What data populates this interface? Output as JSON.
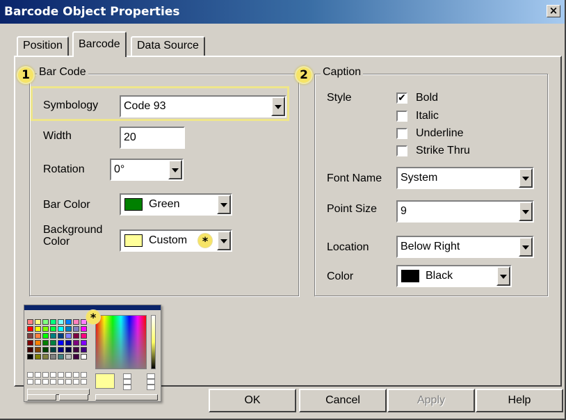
{
  "window": {
    "title": "Barcode Object Properties",
    "close_glyph": "×"
  },
  "tabs": [
    {
      "label": "Position",
      "active": false
    },
    {
      "label": "Barcode",
      "active": true
    },
    {
      "label": "Data Source",
      "active": false
    }
  ],
  "barcode_group": {
    "badge": "1",
    "title": "Bar Code",
    "symbology": {
      "label": "Symbology",
      "value": "Code 93"
    },
    "width": {
      "label": "Width",
      "value": "20"
    },
    "rotation": {
      "label": "Rotation",
      "value": "0°"
    },
    "bar_color": {
      "label": "Bar Color",
      "value": "Green",
      "swatch": "#008000"
    },
    "background_color": {
      "label_line1": "Background",
      "label_line2": "Color",
      "value": "Custom",
      "swatch": "#ffff99",
      "marker": "*"
    }
  },
  "caption_group": {
    "badge": "2",
    "title": "Caption",
    "style_label": "Style",
    "styles": [
      {
        "label": "Bold",
        "checked": true
      },
      {
        "label": "Italic",
        "checked": false
      },
      {
        "label": "Underline",
        "checked": false
      },
      {
        "label": "Strike Thru",
        "checked": false
      }
    ],
    "font_name": {
      "label": "Font Name",
      "value": "System"
    },
    "point_size": {
      "label": "Point Size",
      "value": "9"
    },
    "location": {
      "label": "Location",
      "value": "Below Right"
    },
    "color": {
      "label": "Color",
      "value": "Black",
      "swatch": "#000000"
    }
  },
  "color_dialog_thumbnail": {
    "marker": "*",
    "selected_color": "#ffff99"
  },
  "buttons": {
    "ok": "OK",
    "cancel": "Cancel",
    "apply": "Apply",
    "help": "Help"
  },
  "check_glyph": "✔",
  "colors": {
    "face": "#d4d0c8",
    "title_start": "#0a246a",
    "title_end": "#a6caf0",
    "highlight": "#f6e466"
  }
}
